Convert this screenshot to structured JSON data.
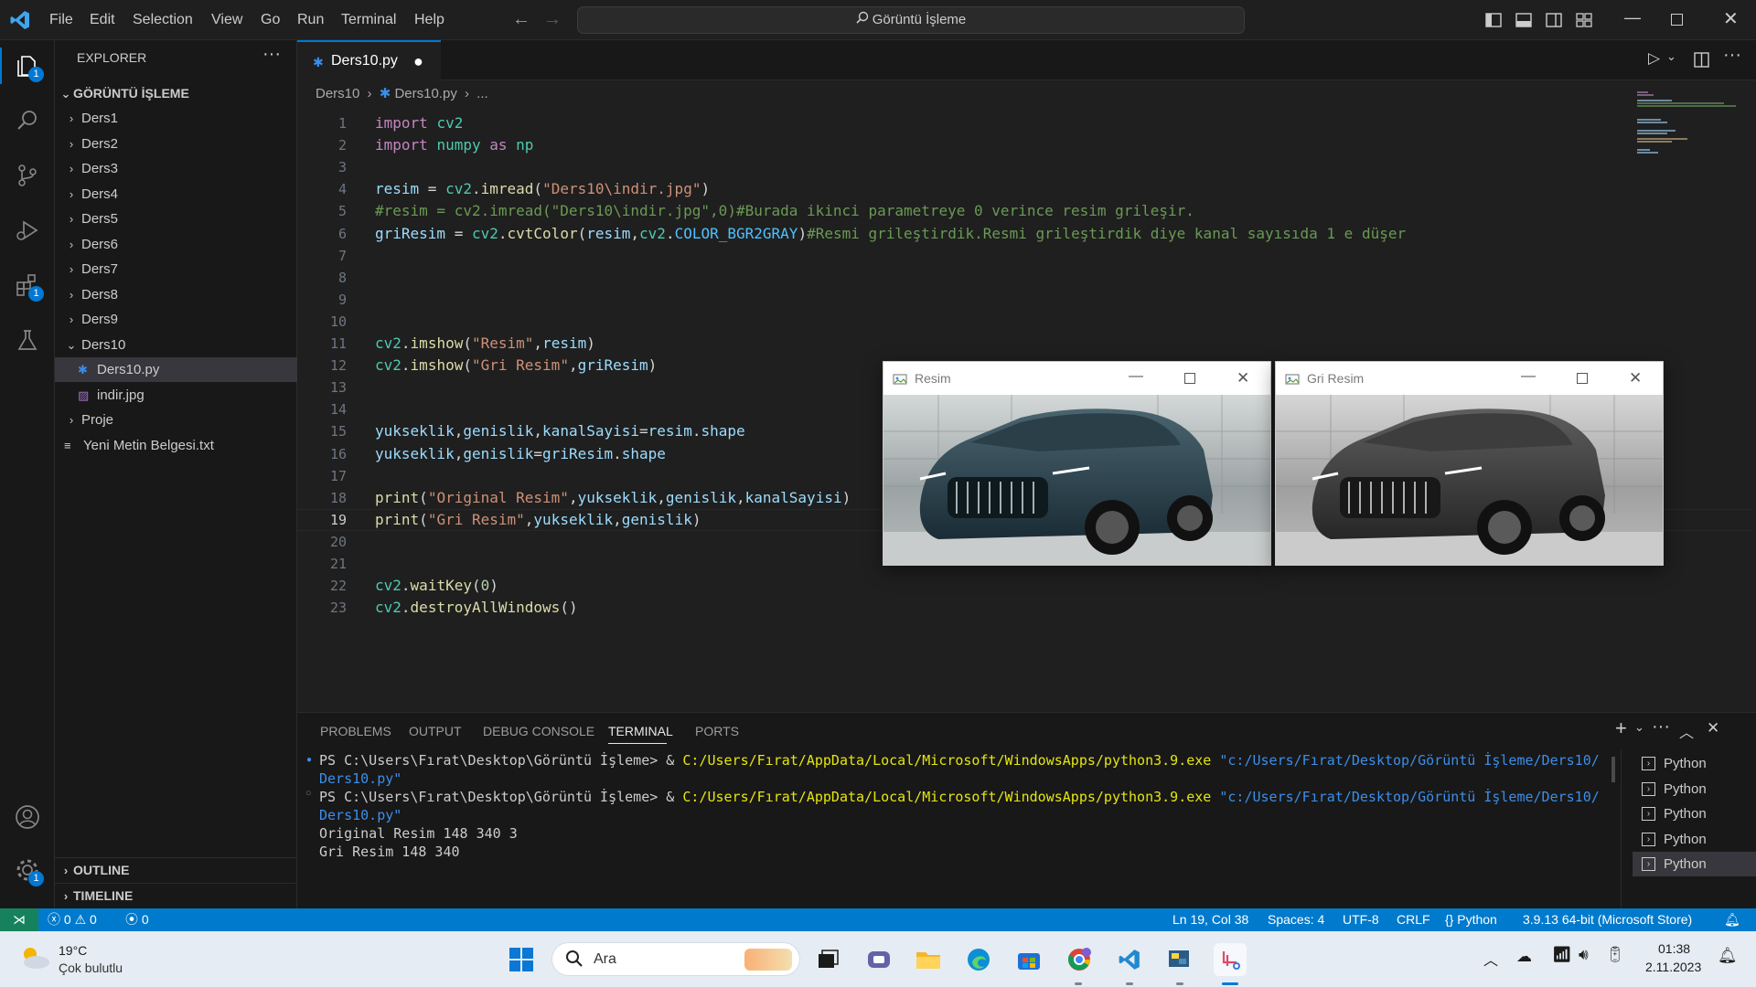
{
  "titlebar": {
    "menu": [
      "File",
      "Edit",
      "Selection",
      "View",
      "Go",
      "Run",
      "Terminal",
      "Help"
    ],
    "search": "Görüntü İşleme"
  },
  "activity": {
    "explorer_badge": "1",
    "extensions_badge": "1",
    "settings_badge": "1"
  },
  "sidebar": {
    "title": "EXPLORER",
    "root": "GÖRÜNTÜ İŞLEME",
    "items": [
      {
        "label": "Ders1",
        "type": "folder"
      },
      {
        "label": "Ders2",
        "type": "folder"
      },
      {
        "label": "Ders3",
        "type": "folder"
      },
      {
        "label": "Ders4",
        "type": "folder"
      },
      {
        "label": "Ders5",
        "type": "folder"
      },
      {
        "label": "Ders6",
        "type": "folder"
      },
      {
        "label": "Ders7",
        "type": "folder"
      },
      {
        "label": "Ders8",
        "type": "folder"
      },
      {
        "label": "Ders9",
        "type": "folder"
      },
      {
        "label": "Ders10",
        "type": "folder-open"
      },
      {
        "label": "Ders10.py",
        "type": "py"
      },
      {
        "label": "indir.jpg",
        "type": "img"
      },
      {
        "label": "Proje",
        "type": "folder"
      },
      {
        "label": "Yeni Metin Belgesi.txt",
        "type": "txt"
      }
    ],
    "outline": "OUTLINE",
    "timeline": "TIMELINE"
  },
  "editor": {
    "tab": "Ders10.py",
    "breadcrumb": [
      "Ders10",
      "Ders10.py",
      "..."
    ],
    "current_line": "19",
    "lines": [
      "1",
      "2",
      "3",
      "4",
      "5",
      "6",
      "7",
      "8",
      "9",
      "10",
      "11",
      "12",
      "13",
      "14",
      "15",
      "16",
      "17",
      "18",
      "19",
      "20",
      "21",
      "22",
      "23"
    ],
    "code": [
      "import cv2",
      "import numpy as np",
      "",
      "resim = cv2.imread(\"Ders10\\indir.jpg\")",
      "#resim = cv2.imread(\"Ders10\\indir.jpg\",0)#Burada ikinci parametreye 0 verince resim grileşir.",
      "griResim = cv2.cvtColor(resim,cv2.COLOR_BGR2GRAY)#Resmi grileştirdik.Resmi grileştirdik diye kanal sayısıda 1 e düşer",
      "",
      "",
      "",
      "",
      "cv2.imshow(\"Resim\",resim)",
      "cv2.imshow(\"Gri Resim\",griResim)",
      "",
      "",
      "yukseklik,genislik,kanalSayisi=resim.shape",
      "yukseklik,genislik=griResim.shape",
      "",
      "print(\"Original Resim\",yukseklik,genislik,kanalSayisi)",
      "print(\"Gri Resim\",yukseklik,genislik)",
      "",
      "",
      "cv2.waitKey(0)",
      "cv2.destroyAllWindows()"
    ]
  },
  "windows": [
    {
      "title": "Resim",
      "mode": "color"
    },
    {
      "title": "Gri Resim",
      "mode": "gray"
    }
  ],
  "panel": {
    "tabs": [
      "PROBLEMS",
      "OUTPUT",
      "DEBUG CONSOLE",
      "TERMINAL",
      "PORTS"
    ],
    "active_tab": "TERMINAL",
    "terminal": [
      {
        "prompt": "PS C:\\Users\\Fırat\\Desktop\\Görüntü İşleme> & ",
        "exe": "C:/Users/Fırat/AppData/Local/Microsoft/WindowsApps/python3.9.exe",
        "arg": " \"c:/Users/Fırat/Desktop/Görüntü İşleme/Ders10/",
        "arg2": "Ders10.py\""
      },
      {
        "prompt": "PS C:\\Users\\Fırat\\Desktop\\Görüntü İşleme> & ",
        "exe": "C:/Users/Fırat/AppData/Local/Microsoft/WindowsApps/python3.9.exe",
        "arg": " \"c:/Users/Fırat/Desktop/Görüntü İşleme/Ders10/",
        "arg2": "Ders10.py\""
      }
    ],
    "output": [
      "Original Resim 148 340 3",
      "Gri Resim 148 340"
    ],
    "terminals": [
      "Python",
      "Python",
      "Python",
      "Python",
      "Python"
    ]
  },
  "status": {
    "errors": "0",
    "warnings": "0",
    "ports": "0",
    "position": "Ln 19, Col 38",
    "spaces": "Spaces: 4",
    "encoding": "UTF-8",
    "eol": "CRLF",
    "language": "Python",
    "interpreter": "3.9.13 64-bit (Microsoft Store)"
  },
  "taskbar": {
    "weather_temp": "19°C",
    "weather_desc": "Çok bulutlu",
    "search": "Ara",
    "time": "01:38",
    "date": "2.11.2023"
  },
  "colors": {
    "accent": "#0078d4",
    "statusbar": "#007acc"
  }
}
